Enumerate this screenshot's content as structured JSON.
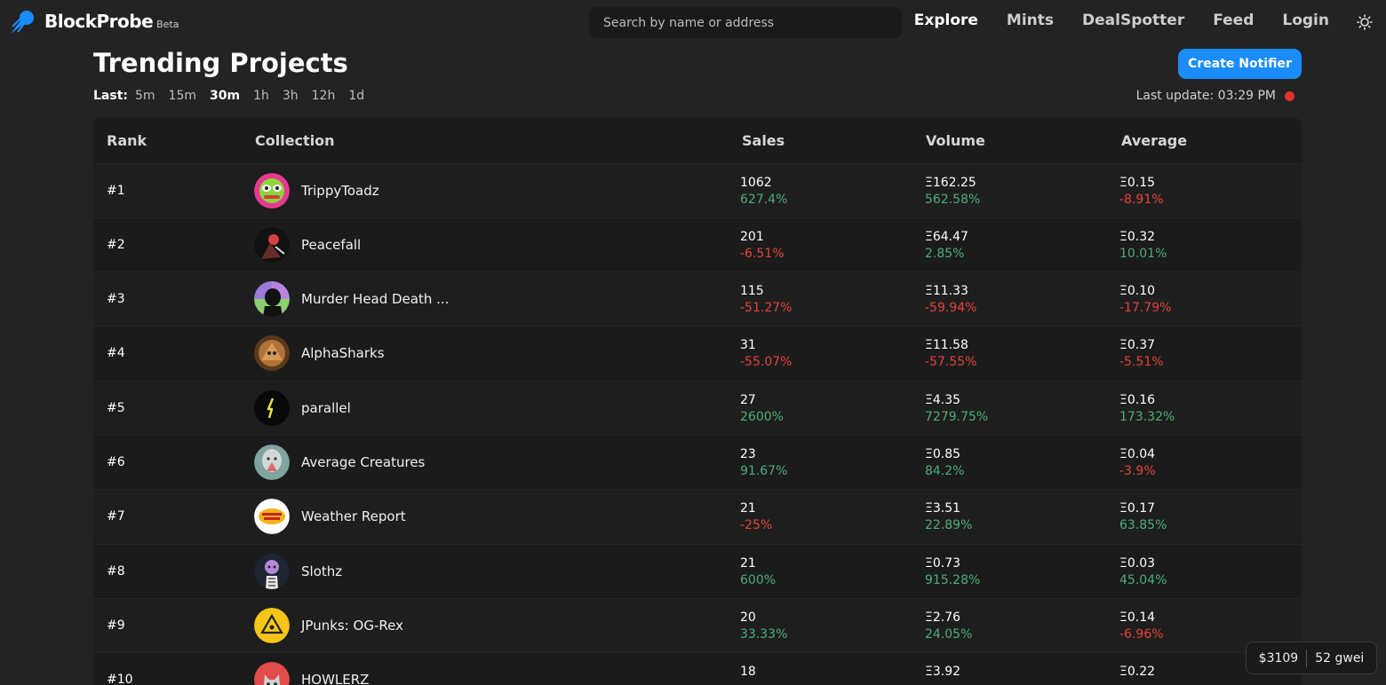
{
  "brand": {
    "name": "BlockProbe",
    "badge": "Beta"
  },
  "search": {
    "placeholder": "Search by name or address"
  },
  "nav": [
    "Explore",
    "Mints",
    "DealSpotter",
    "Feed",
    "Login"
  ],
  "page": {
    "title": "Trending Projects",
    "create_label": "Create Notifier",
    "last_update": "Last update: 03:29 PM"
  },
  "range": {
    "label": "Last:",
    "options": [
      "5m",
      "15m",
      "30m",
      "1h",
      "3h",
      "12h",
      "1d"
    ],
    "selected": "30m"
  },
  "table": {
    "headers": [
      "Rank",
      "Collection",
      "Sales",
      "Volume",
      "Average"
    ],
    "rows": [
      {
        "rank": "#1",
        "name": "TrippyToadz",
        "sales": "1062",
        "sales_change": "627.4%",
        "volume": "Ξ162.25",
        "volume_change": "562.58%",
        "average": "Ξ0.15",
        "average_change": "-8.91%",
        "avatar": "toad-avatar"
      },
      {
        "rank": "#2",
        "name": "Peacefall",
        "sales": "201",
        "sales_change": "-6.51%",
        "volume": "Ξ64.47",
        "volume_change": "2.85%",
        "average": "Ξ0.32",
        "average_change": "10.01%",
        "avatar": "warrior-avatar"
      },
      {
        "rank": "#3",
        "name": "Murder Head Death ...",
        "sales": "115",
        "sales_change": "-51.27%",
        "volume": "Ξ11.33",
        "volume_change": "-59.94%",
        "average": "Ξ0.10",
        "average_change": "-17.79%",
        "avatar": "silhouette-avatar"
      },
      {
        "rank": "#4",
        "name": "AlphaSharks",
        "sales": "31",
        "sales_change": "-55.07%",
        "volume": "Ξ11.58",
        "volume_change": "-57.55%",
        "average": "Ξ0.37",
        "average_change": "-5.51%",
        "avatar": "shark-avatar"
      },
      {
        "rank": "#5",
        "name": "parallel",
        "sales": "27",
        "sales_change": "2600%",
        "volume": "Ξ4.35",
        "volume_change": "7279.75%",
        "average": "Ξ0.16",
        "average_change": "173.32%",
        "avatar": "parallel-avatar"
      },
      {
        "rank": "#6",
        "name": "Average Creatures",
        "sales": "23",
        "sales_change": "91.67%",
        "volume": "Ξ0.85",
        "volume_change": "84.2%",
        "average": "Ξ0.04",
        "average_change": "-3.9%",
        "avatar": "creature-avatar"
      },
      {
        "rank": "#7",
        "name": "Weather Report",
        "sales": "21",
        "sales_change": "-25%",
        "volume": "Ξ3.51",
        "volume_change": "22.89%",
        "average": "Ξ0.17",
        "average_change": "63.85%",
        "avatar": "weather-avatar"
      },
      {
        "rank": "#8",
        "name": "Slothz",
        "sales": "21",
        "sales_change": "600%",
        "volume": "Ξ0.73",
        "volume_change": "915.28%",
        "average": "Ξ0.03",
        "average_change": "45.04%",
        "avatar": "sloth-avatar"
      },
      {
        "rank": "#9",
        "name": "JPunks: OG-Rex",
        "sales": "20",
        "sales_change": "33.33%",
        "volume": "Ξ2.76",
        "volume_change": "24.05%",
        "average": "Ξ0.14",
        "average_change": "-6.96%",
        "avatar": "jpunks-avatar"
      },
      {
        "rank": "#10",
        "name": "HOWLERZ",
        "sales": "18",
        "sales_change": "",
        "volume": "Ξ3.92",
        "volume_change": "",
        "average": "Ξ0.22",
        "average_change": "",
        "avatar": "wolf-avatar"
      }
    ]
  },
  "gas": {
    "price": "$3109",
    "gwei": "52 gwei"
  },
  "colors": {
    "accent": "#1a8cff",
    "positive": "#4caf7d",
    "negative": "#e5453a",
    "live": "#e5322d"
  }
}
